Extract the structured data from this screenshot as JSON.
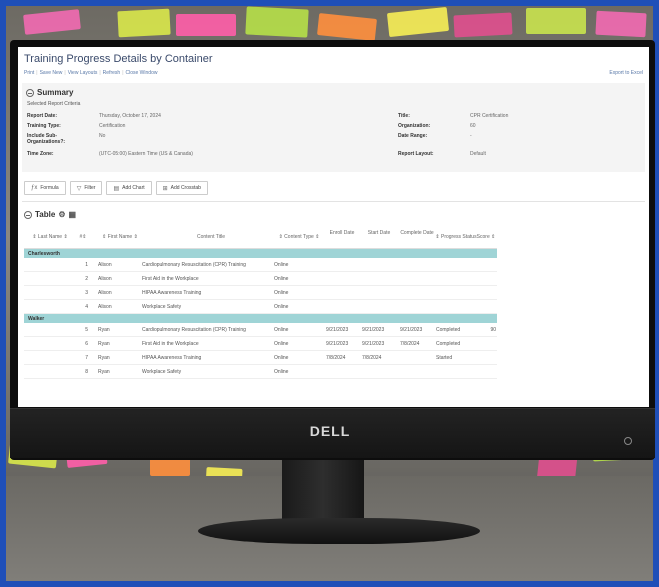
{
  "photo": {
    "brand": "DELL",
    "background_color": "#1f4fb8",
    "note_colors": [
      "#f26ab1",
      "#d9e84a",
      "#ff5ea8",
      "#b6e048",
      "#ff8f3d",
      "#f7ee55",
      "#e04f8e",
      "#c9e34e"
    ]
  },
  "app": {
    "title": "Training Progress Details by Container",
    "toolbar": [
      "Print",
      "Save New",
      "View Layouts",
      "Refresh",
      "Close Window"
    ],
    "export_label": "Export to Excel"
  },
  "summary": {
    "heading": "Summary",
    "subheading": "Selected Report Criteria",
    "left_fields": [
      {
        "label": "Report Date:",
        "value": "Thursday, October 17, 2024"
      },
      {
        "label": "Training Type:",
        "value": "Certification"
      },
      {
        "label": "Include Sub-Organizations?:",
        "value": "No"
      },
      {
        "label": "Time Zone:",
        "value": "(UTC-05:00) Eastern Time (US & Canada)"
      }
    ],
    "right_fields": [
      {
        "label": "Title:",
        "value": "CPR Certification"
      },
      {
        "label": "Organization:",
        "value": "60"
      },
      {
        "label": "Date Range:",
        "value": "-"
      },
      {
        "label": "Report Layout:",
        "value": "Default"
      }
    ]
  },
  "actions": [
    "Formula",
    "Filter",
    "Add Chart",
    "Add Crosstab"
  ],
  "table": {
    "heading": "Table",
    "columns": [
      "Last Name",
      "#",
      "First Name",
      "Content Title",
      "Content Type",
      "Enroll Date",
      "Start Date",
      "Complete Date",
      "Progress Status",
      "Score"
    ],
    "groups": [
      {
        "name": "Charlesworth",
        "rows": [
          {
            "num": "1",
            "first": "Alison",
            "title": "Cardiopulmonary Resuscitation (CPR) Training",
            "type": "Online",
            "enroll": "",
            "start": "",
            "complete": "",
            "status": "",
            "score": ""
          },
          {
            "num": "2",
            "first": "Alison",
            "title": "First Aid in the Workplace",
            "type": "Online",
            "enroll": "",
            "start": "",
            "complete": "",
            "status": "",
            "score": ""
          },
          {
            "num": "3",
            "first": "Alison",
            "title": "HIPAA Awareness Training",
            "type": "Online",
            "enroll": "",
            "start": "",
            "complete": "",
            "status": "",
            "score": ""
          },
          {
            "num": "4",
            "first": "Alison",
            "title": "Workplace Safety",
            "type": "Online",
            "enroll": "",
            "start": "",
            "complete": "",
            "status": "",
            "score": ""
          }
        ]
      },
      {
        "name": "Walker",
        "rows": [
          {
            "num": "5",
            "first": "Ryan",
            "title": "Cardiopulmonary Resuscitation (CPR) Training",
            "type": "Online",
            "enroll": "9/21/2023",
            "start": "9/21/2023",
            "complete": "9/21/2023",
            "status": "Completed",
            "score": "90"
          },
          {
            "num": "6",
            "first": "Ryan",
            "title": "First Aid in the Workplace",
            "type": "Online",
            "enroll": "9/21/2023",
            "start": "9/21/2023",
            "complete": "7/8/2024",
            "status": "Completed",
            "score": ""
          },
          {
            "num": "7",
            "first": "Ryan",
            "title": "HIPAA Awareness Training",
            "type": "Online",
            "enroll": "7/8/2024",
            "start": "7/8/2024",
            "complete": "",
            "status": "Started",
            "score": ""
          },
          {
            "num": "8",
            "first": "Ryan",
            "title": "Workplace Safety",
            "type": "Online",
            "enroll": "",
            "start": "",
            "complete": "",
            "status": "",
            "score": ""
          }
        ]
      }
    ]
  }
}
